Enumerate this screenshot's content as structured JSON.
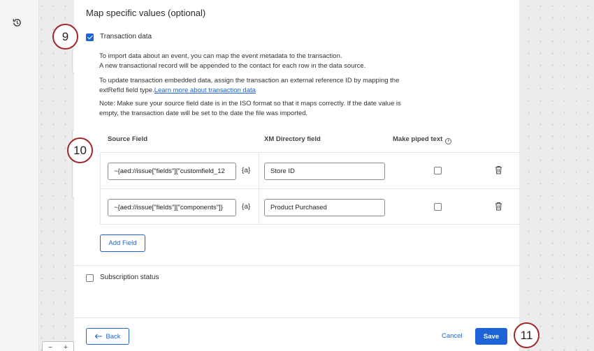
{
  "modal": {
    "section_title": "Map specific values (optional)",
    "transaction_checkbox": {
      "label": "Transaction data",
      "checked": true
    },
    "paragraphs": {
      "p1_line1": "To import data about an event, you can map the event metadata to the transaction.",
      "p1_line2": "A new transactional record will be appended to the contact for each row in the data source.",
      "p2_line1": "To update transaction embedded data, assign the transaction an external reference ID by mapping the",
      "p2_line2": "extRefId field type.",
      "p2_link": "Learn more about transaction data",
      "p3_line1": "Note: Make sure your source field date is in the ISO format so that it maps correctly. If the date value is",
      "p3_line2": "empty, the transaction date will be set to the date the file was imported."
    },
    "table": {
      "headers": {
        "source": "Source Field",
        "xm": "XM Directory field",
        "piped": "Make piped text"
      },
      "info_glyph": "i",
      "piped_glyph": "{a}",
      "rows": [
        {
          "source": "~{aed://issue[\"fields\"][\"customfield_12",
          "xm": "Store ID",
          "piped": false
        },
        {
          "source": "~{aed://issue[\"fields\"][\"components\"]}",
          "xm": "Product Purchased",
          "piped": false
        }
      ]
    },
    "add_field_label": "Add Field",
    "subscription_checkbox": {
      "label": "Subscription status",
      "checked": false
    },
    "footer": {
      "back_label": "Back",
      "cancel_label": "Cancel",
      "save_label": "Save"
    }
  },
  "canvas": {
    "zoom_minus": "−",
    "zoom_plus": "+"
  },
  "step_badges": [
    "9",
    "10",
    "11"
  ],
  "colors": {
    "accent": "#1d63d6",
    "badge_ring": "#a3262a"
  },
  "icons": [
    "history-icon",
    "info-icon",
    "trash-icon",
    "arrow-left-icon",
    "piped-text-icon"
  ]
}
